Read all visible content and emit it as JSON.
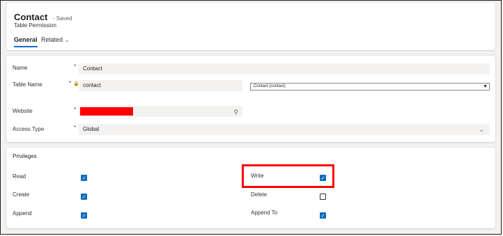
{
  "header": {
    "title": "Contact",
    "status": "- Saved",
    "subtitle": "Table Permission",
    "tabs": [
      {
        "label": "General",
        "selected": true
      },
      {
        "label": "Related",
        "selected": false
      }
    ],
    "related_chevron": "chevron-down-icon"
  },
  "fields": {
    "name": {
      "label": "Name",
      "required": "*",
      "value": "Contact"
    },
    "table_name": {
      "label": "Table Name",
      "required": "*",
      "value": "contact",
      "select_value": "Contact (contact)"
    },
    "website": {
      "label": "Website",
      "required": "*",
      "value": "",
      "redacted": true
    },
    "access_type": {
      "label": "Access Type",
      "required": "*",
      "value": "Global"
    }
  },
  "privileges": {
    "title": "Privileges",
    "items": [
      {
        "label": "Read",
        "checked": true
      },
      {
        "label": "Create",
        "checked": true
      },
      {
        "label": "Append",
        "checked": true
      },
      {
        "label": "Write",
        "checked": true
      },
      {
        "label": "Delete",
        "checked": false
      },
      {
        "label": "Append To",
        "checked": true
      }
    ]
  },
  "colors": {
    "accent": "#0f6cbd",
    "required": "#a4262c",
    "highlight": "#ff0000"
  }
}
